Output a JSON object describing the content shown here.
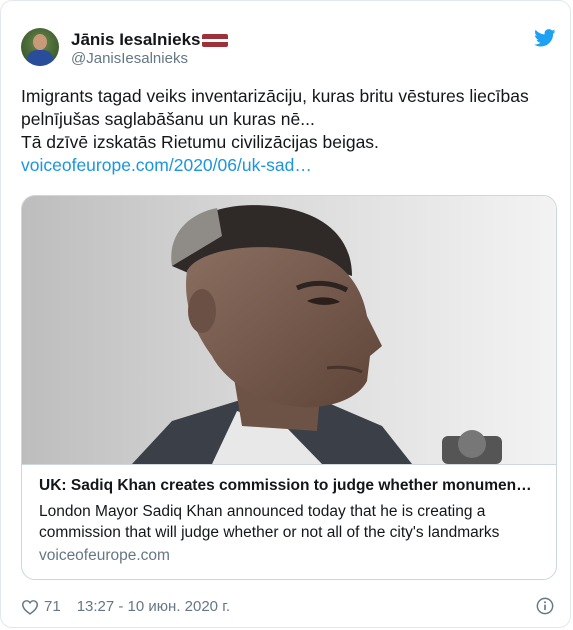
{
  "author": {
    "name": "Jānis Iesalnieks",
    "handle": "@JanisIesalnieks",
    "avatar_icon": "avatar-photo",
    "flag_icon": "latvia-flag",
    "flag_colors": [
      "#9e3039",
      "#ffffff",
      "#9e3039"
    ]
  },
  "brand_icon": "twitter-bird-icon",
  "brand_color": "#1da1f2",
  "tweet": {
    "lines": [
      "Imigrants tagad veiks inventarizāciju, kuras britu vēstures liecības",
      "pelnījušas saglabāšanu un kuras nē...",
      "Tā dzīvē izskatās Rietumu civilizācijas beigas."
    ],
    "link": "voiceofeurope.com/2020/06/uk-sad…",
    "link_color": "#1b95e0"
  },
  "card": {
    "image_icon": "article-photo",
    "title": "UK: Sadiq Khan creates commission to judge whether monumen…",
    "description_lines": [
      "London Mayor Sadiq Khan announced today that he is creating a",
      "commission that will judge whether or not all of the city's landmarks"
    ],
    "domain": "voiceofeurope.com"
  },
  "footer": {
    "heart_icon": "heart-icon",
    "likes": "71",
    "timestamp": "13:27 - 10 июн. 2020 г.",
    "info_icon": "info-icon"
  }
}
